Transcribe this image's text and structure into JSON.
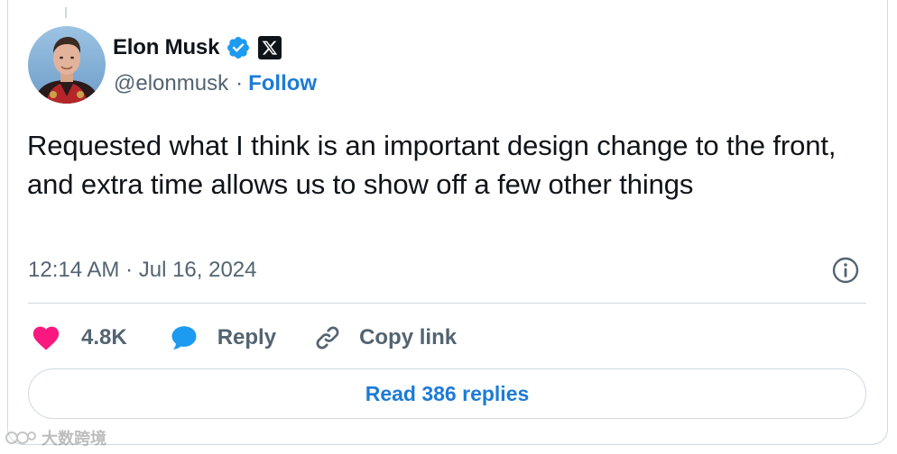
{
  "author": {
    "name": "Elon Musk",
    "handle": "@elonmusk",
    "separator": "·",
    "follow_label": "Follow"
  },
  "tweet": {
    "text": "Requested what I think is an important design change to the front, and extra time allows us to show off a few other things",
    "timestamp": "12:14 AM · Jul 16, 2024"
  },
  "actions": {
    "like_count": "4.8K",
    "reply_label": "Reply",
    "copy_link_label": "Copy link"
  },
  "read_replies_label": "Read 386 replies",
  "watermark_text": "大数跨境",
  "colors": {
    "accent": "#1d7bd6",
    "like": "#f91880",
    "reply": "#1d9bf0",
    "text_primary": "#0f1419",
    "text_secondary": "#536471",
    "border": "#cfd9de"
  },
  "icons": {
    "verified": "verified-badge-icon",
    "x_logo": "x-logo-icon",
    "info": "info-icon",
    "like": "heart-icon",
    "reply": "speech-bubble-icon",
    "copy_link": "link-icon"
  }
}
